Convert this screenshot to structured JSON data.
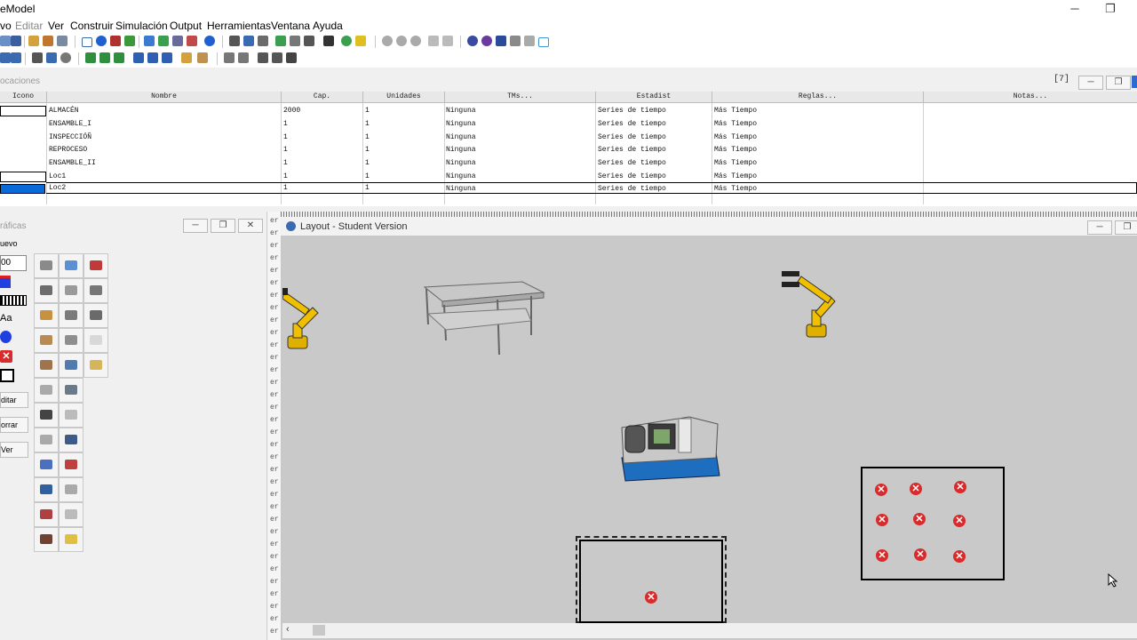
{
  "window": {
    "title": "eModel",
    "min_glyph": "─",
    "restore_glyph": "❐"
  },
  "menu": [
    "vo",
    "Editar",
    "Ver",
    "Construir",
    "Simulación",
    "Output",
    "Herramientas",
    "Ventana",
    "Ayuda"
  ],
  "locations": {
    "title": "ocaciones",
    "count": "[7]",
    "columns": [
      "Icono",
      "Nombre",
      "Cap.",
      "Unidades",
      "TMs...",
      "Estadist",
      "Reglas...",
      "Notas..."
    ],
    "rows": [
      {
        "nombre": "ALMACÉN",
        "cap": "2000",
        "unidades": "1",
        "tms": "Ninguna",
        "estadist": "Series de tiempo",
        "reglas": "Más Tiempo"
      },
      {
        "nombre": "ENSAMBLE_I",
        "cap": "1",
        "unidades": "1",
        "tms": "Ninguna",
        "estadist": "Series de tiempo",
        "reglas": "Más Tiempo"
      },
      {
        "nombre": "INSPECCIÓÑ",
        "cap": "1",
        "unidades": "1",
        "tms": "Ninguna",
        "estadist": "Series de tiempo",
        "reglas": "Más Tiempo"
      },
      {
        "nombre": "REPROCESO",
        "cap": "1",
        "unidades": "1",
        "tms": "Ninguna",
        "estadist": "Series de tiempo",
        "reglas": "Más Tiempo"
      },
      {
        "nombre": "ENSAMBLE_II",
        "cap": "1",
        "unidades": "1",
        "tms": "Ninguna",
        "estadist": "Series de tiempo",
        "reglas": "Más Tiempo"
      },
      {
        "nombre": "Loc1",
        "cap": "1",
        "unidades": "1",
        "tms": "Ninguna",
        "estadist": "Series de tiempo",
        "reglas": "Más Tiempo"
      },
      {
        "nombre": "Loc2",
        "cap": "1",
        "unidades": "1",
        "tms": "Ninguna",
        "estadist": "Series de tiempo",
        "reglas": "Más Tiempo"
      }
    ]
  },
  "graphics": {
    "title": "ráficas",
    "nuevo": "uevo",
    "value": "00",
    "text_tool": "Aa",
    "buttons": [
      "ditar",
      "orrar",
      "Ver"
    ],
    "icon_colors": [
      "#8a8a8a",
      "#5b8fd6",
      "#c03a3a",
      "#6d6d6d",
      "#9a9a9a",
      "#777",
      "#c8913e",
      "#7b7b7b",
      "#6a6a6a",
      "#b98b52",
      "#8e8e8e",
      "#d8d8d8",
      "#a0744a",
      "#4e7bb0",
      "#d6b55a",
      "#aaa",
      "#6a7a8a",
      "#e0c020",
      "#444",
      "#bbb",
      "#c89060",
      "#aaa",
      "#3c5a8a",
      "#aaa",
      "#4a70c0",
      "#c04040",
      "#d04040",
      "#3060a0",
      "#aaa",
      "#777",
      "#b04040",
      "#bbb",
      "#8a7a50",
      "#704030",
      "#e0c040",
      "#555"
    ]
  },
  "layout": {
    "title": "Layout - Student Version"
  },
  "colors": {
    "selection": "#0a6ad8",
    "xmark": "#d92b2b"
  }
}
